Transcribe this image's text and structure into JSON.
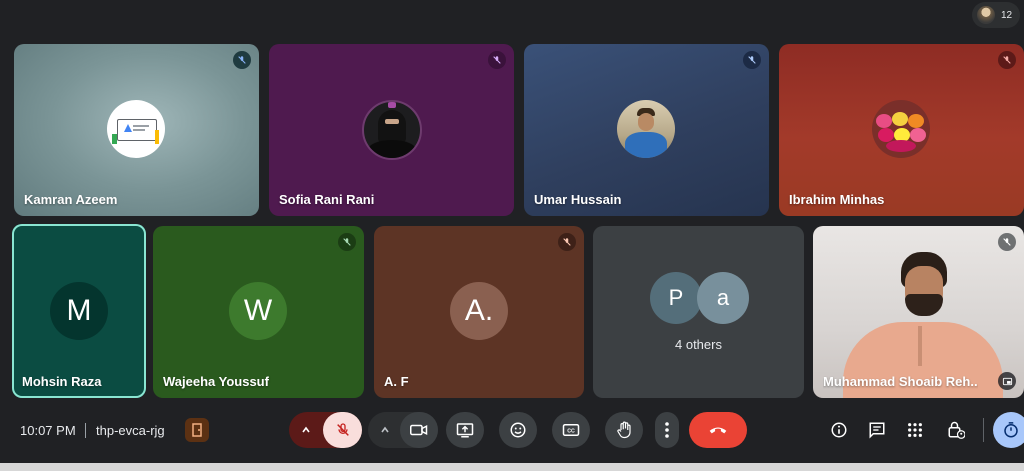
{
  "top_bar": {
    "participant_count": "12"
  },
  "participants": [
    {
      "name": "Kamran Azeem",
      "muted": true,
      "avatar": "google-ads-logo"
    },
    {
      "name": "Sofia Rani Rani",
      "muted": true,
      "avatar": "hijab-photo"
    },
    {
      "name": "Umar Hussain",
      "muted": true,
      "avatar": "profile-photo"
    },
    {
      "name": "Ibrahim Minhas",
      "muted": true,
      "avatar": "yarn-balls-photo"
    },
    {
      "name": "Mohsin Raza",
      "letter": "M",
      "active_speaker": true
    },
    {
      "name": "Wajeeha Youssuf",
      "letter": "W",
      "muted": true
    },
    {
      "name": "A. F",
      "letter": "A.",
      "muted": true
    },
    {
      "others_label": "4 others",
      "others_letters": [
        "P",
        "a"
      ]
    },
    {
      "name": "Muhammad Shoaib Reh...",
      "muted": true,
      "video": true
    }
  ],
  "bottom_bar": {
    "time": "10:07 PM",
    "meeting_code": "thp-evca-rjg"
  },
  "colors": {
    "background": "#202124",
    "end_call": "#ea4335",
    "mic_muted_bg": "#f9dedc",
    "active_speaker_border": "#8ae6d2"
  }
}
